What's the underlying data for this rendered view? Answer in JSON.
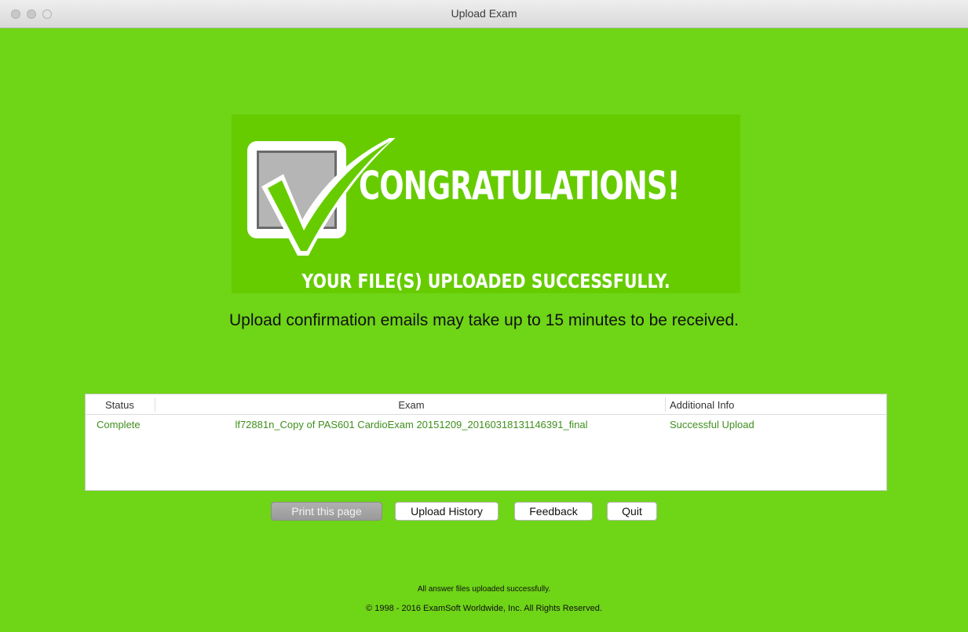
{
  "window": {
    "title": "Upload Exam"
  },
  "banner": {
    "headline": "CONGRATULATIONS!",
    "subheadline": "YOUR FILE(S) UPLOADED SUCCESSFULLY."
  },
  "message": "Upload confirmation emails may take up to 15 minutes to be received.",
  "table": {
    "headers": {
      "status": "Status",
      "exam": "Exam",
      "info": "Additional Info"
    },
    "rows": [
      {
        "status": "Complete",
        "exam": "lf72881n_Copy of PAS601 CardioExam 20151209_20160318131146391_final",
        "info": "Successful Upload"
      }
    ]
  },
  "buttons": {
    "print": "Print this page",
    "history": "Upload History",
    "feedback": "Feedback",
    "quit": "Quit"
  },
  "footer": {
    "status": "All answer files uploaded successfully.",
    "copyright": "© 1998 - 2016 ExamSoft Worldwide, Inc. All Rights Reserved."
  },
  "colors": {
    "background": "#6fd517",
    "banner": "#66cc00",
    "success_text": "#3f8f1d"
  }
}
